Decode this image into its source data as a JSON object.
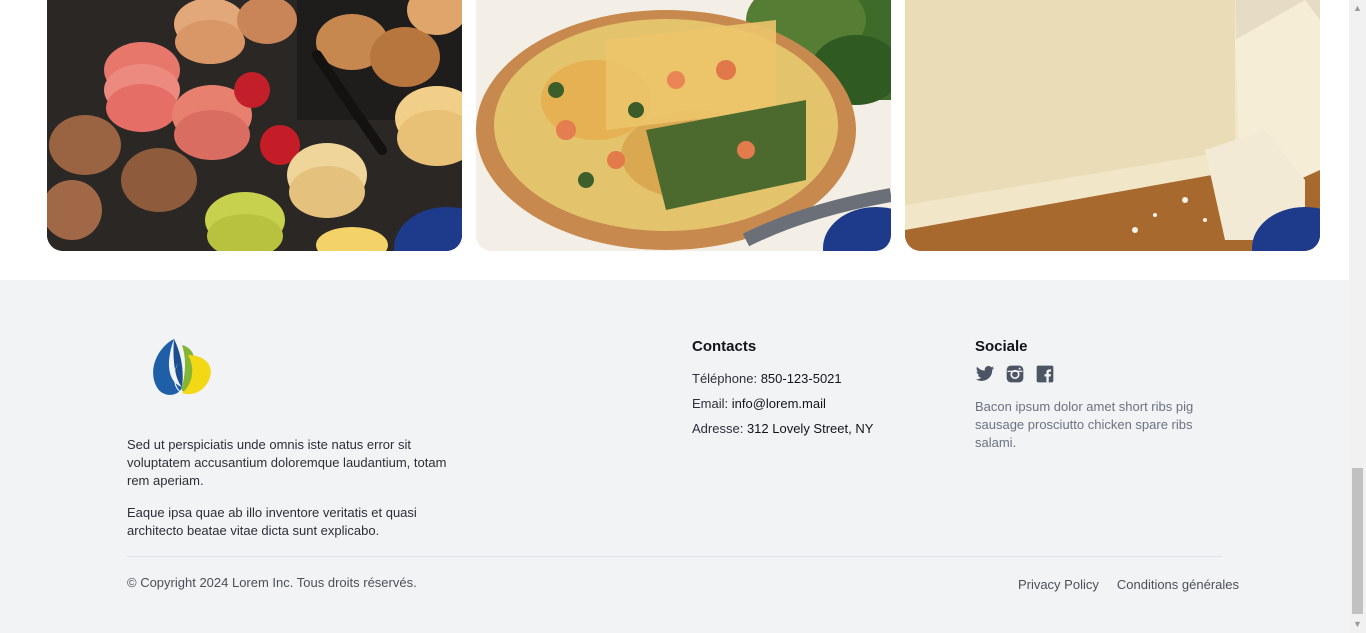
{
  "cards": [
    {
      "alt": "Macarons"
    },
    {
      "alt": "Quiche"
    },
    {
      "alt": "Pâte feuilletée"
    }
  ],
  "footer": {
    "about_1": "Sed ut perspiciatis unde omnis iste natus error sit voluptatem accusantium doloremque laudantium, totam rem aperiam.",
    "about_2": "Eaque ipsa quae ab illo inventore veritatis et quasi architecto beatae vitae dicta sunt explicabo.",
    "contacts": {
      "title": "Contacts",
      "phone_label": "Téléphone:",
      "phone": "850-123-5021",
      "email_label": "Email:",
      "email": "info@lorem.mail",
      "address_label": "Adresse:",
      "address": "312 Lovely Street, NY"
    },
    "social": {
      "title": "Sociale",
      "icons": [
        "twitter-icon",
        "instagram-icon",
        "facebook-icon"
      ],
      "text": "Bacon ipsum dolor amet short ribs pig sausage prosciutto chicken spare ribs salami."
    },
    "copyright": "© Copyright 2024 Lorem Inc. Tous droits réservés.",
    "links": {
      "privacy": "Privacy Policy",
      "terms": "Conditions générales"
    }
  },
  "colors": {
    "accent": "#1e3a8a",
    "footer_bg": "#f2f3f5"
  }
}
